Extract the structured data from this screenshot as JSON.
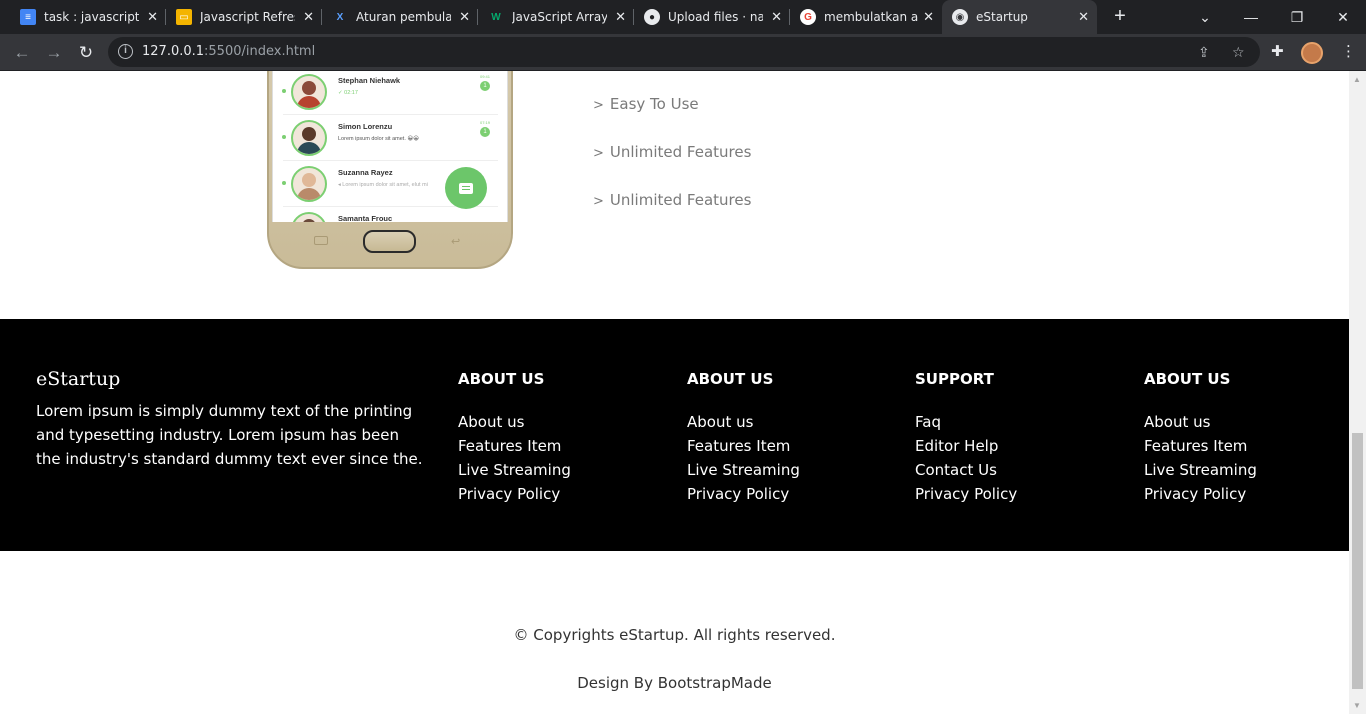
{
  "browser": {
    "tabs": [
      {
        "title": "task : javascript re",
        "icon": "google-docs-icon",
        "color": "#4285f4"
      },
      {
        "title": "Javascript Refresh",
        "icon": "google-slides-icon",
        "color": "#f4b400"
      },
      {
        "title": "Aturan pembulatan",
        "icon": "x-logo-icon",
        "color": "#5aa0ff"
      },
      {
        "title": "JavaScript Array M",
        "icon": "w3schools-icon",
        "color": "#04aa6d"
      },
      {
        "title": "Upload files · nas",
        "icon": "github-icon",
        "color": "#e8eaed"
      },
      {
        "title": "membulatkan an",
        "icon": "google-icon",
        "color": "#ea4335"
      },
      {
        "title": "eStartup",
        "icon": "globe-icon",
        "color": "#e8eaed"
      }
    ],
    "url_host": "127.0.0.1",
    "url_rest": ":5500/index.html"
  },
  "phone": {
    "chats": [
      {
        "name": "Stephan Niehawk",
        "msg": "✓ 02:17",
        "time": "09:41",
        "badge": "1"
      },
      {
        "name": "Simon Lorenzu",
        "msg": "Lorem ipsum dolor sit amet. 😀😀",
        "time": "07:19",
        "badge": "1"
      },
      {
        "name": "Suzanna Rayez",
        "msg": "◂ Lorem ipsum dolor sit amet, elut mi",
        "time": "",
        "badge": ""
      },
      {
        "name": "Samanta Frouc",
        "msg": "",
        "time": "",
        "badge": ""
      }
    ]
  },
  "features": [
    "Easy To Use",
    "Unlimited Features",
    "Unlimited Features"
  ],
  "footer": {
    "brand": "eStartup",
    "about": "Lorem ipsum is simply dummy text of the printing and typesetting industry. Lorem ipsum has been the industry's standard dummy text ever since the.",
    "columns": [
      {
        "heading": "ABOUT US",
        "links": [
          "About us",
          "Features Item",
          "Live Streaming",
          "Privacy Policy"
        ]
      },
      {
        "heading": "ABOUT US",
        "links": [
          "About us",
          "Features Item",
          "Live Streaming",
          "Privacy Policy"
        ]
      },
      {
        "heading": "SUPPORT",
        "links": [
          "Faq",
          "Editor Help",
          "Contact Us",
          "Privacy Policy"
        ]
      },
      {
        "heading": "ABOUT US",
        "links": [
          "About us",
          "Features Item",
          "Live Streaming",
          "Privacy Policy"
        ]
      }
    ]
  },
  "copyright": "© Copyrights eStartup. All rights reserved.",
  "design_prefix": "Design By ",
  "design_link": "BootstrapMade"
}
